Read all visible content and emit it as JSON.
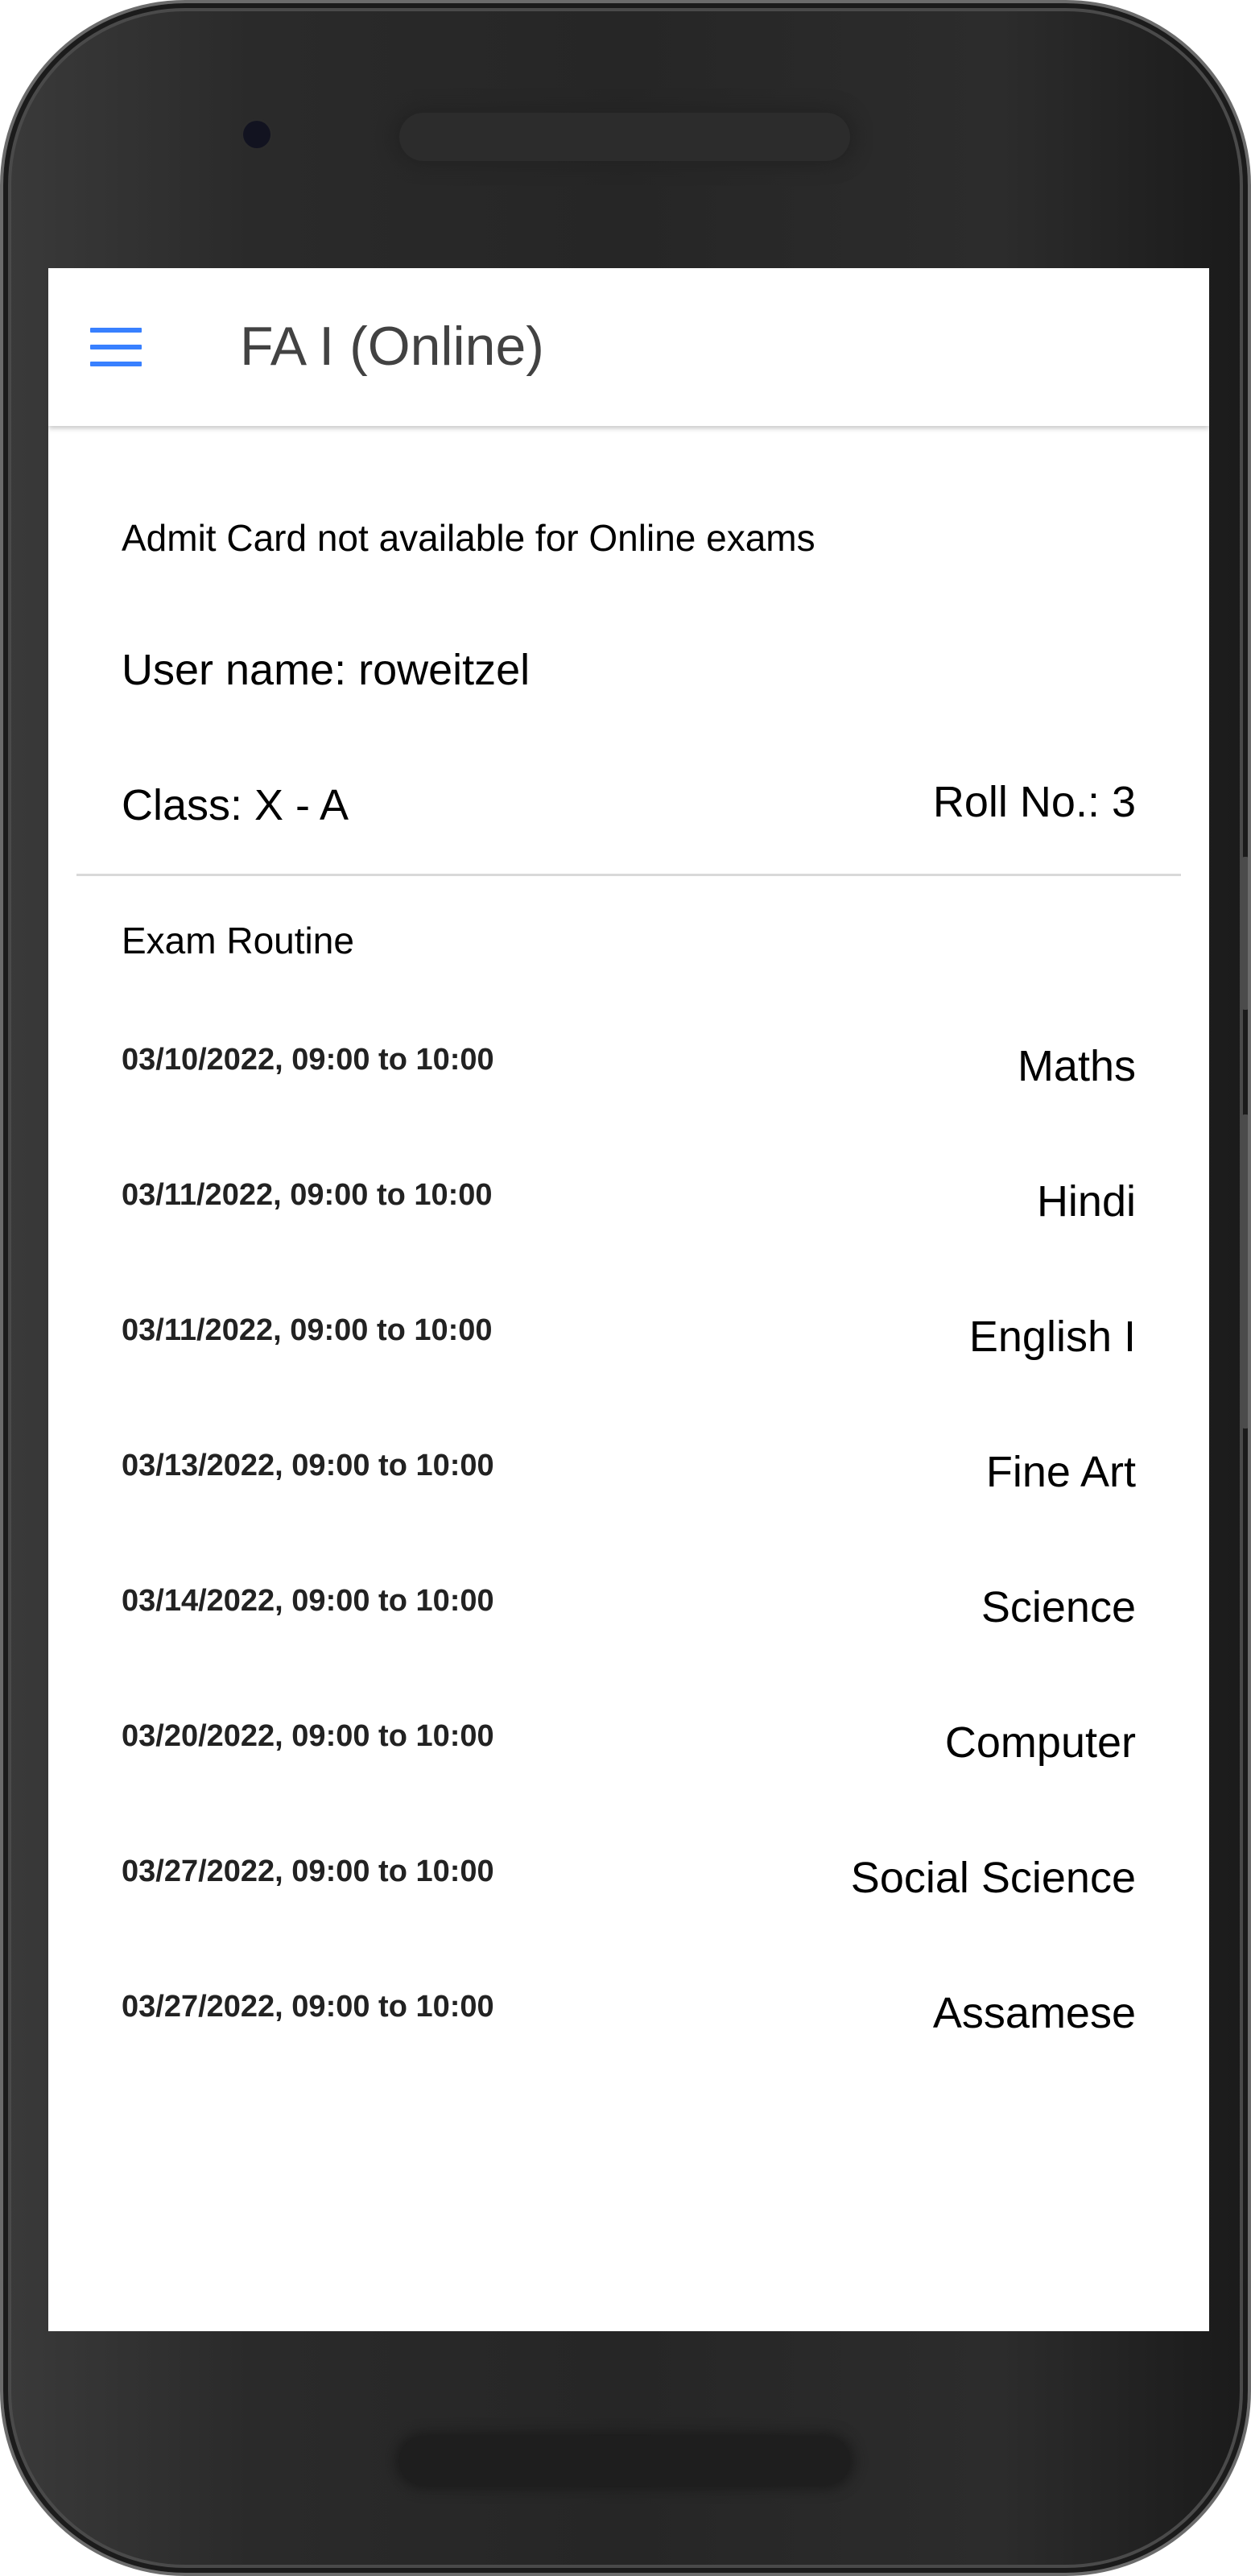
{
  "header": {
    "title": "FA I (Online)",
    "menu_icon": "hamburger-menu-icon",
    "accent_color": "#3880ff"
  },
  "notice": "Admit Card not available for Online exams",
  "student": {
    "username_line": "User name: roweitzel",
    "class_line": "Class: X - A",
    "roll_line": "Roll No.: 3"
  },
  "exam_routine": {
    "title": "Exam Routine",
    "exams": [
      {
        "datetime": "03/10/2022, 09:00 to 10:00",
        "subject": "Maths"
      },
      {
        "datetime": "03/11/2022, 09:00 to 10:00",
        "subject": "Hindi"
      },
      {
        "datetime": "03/11/2022, 09:00 to 10:00",
        "subject": "English I"
      },
      {
        "datetime": "03/13/2022, 09:00 to 10:00",
        "subject": "Fine Art"
      },
      {
        "datetime": "03/14/2022, 09:00 to 10:00",
        "subject": "Science"
      },
      {
        "datetime": "03/20/2022, 09:00 to 10:00",
        "subject": "Computer"
      },
      {
        "datetime": "03/27/2022, 09:00 to 10:00",
        "subject": "Social Science"
      },
      {
        "datetime": "03/27/2022, 09:00 to 10:00",
        "subject": "Assamese"
      }
    ]
  }
}
